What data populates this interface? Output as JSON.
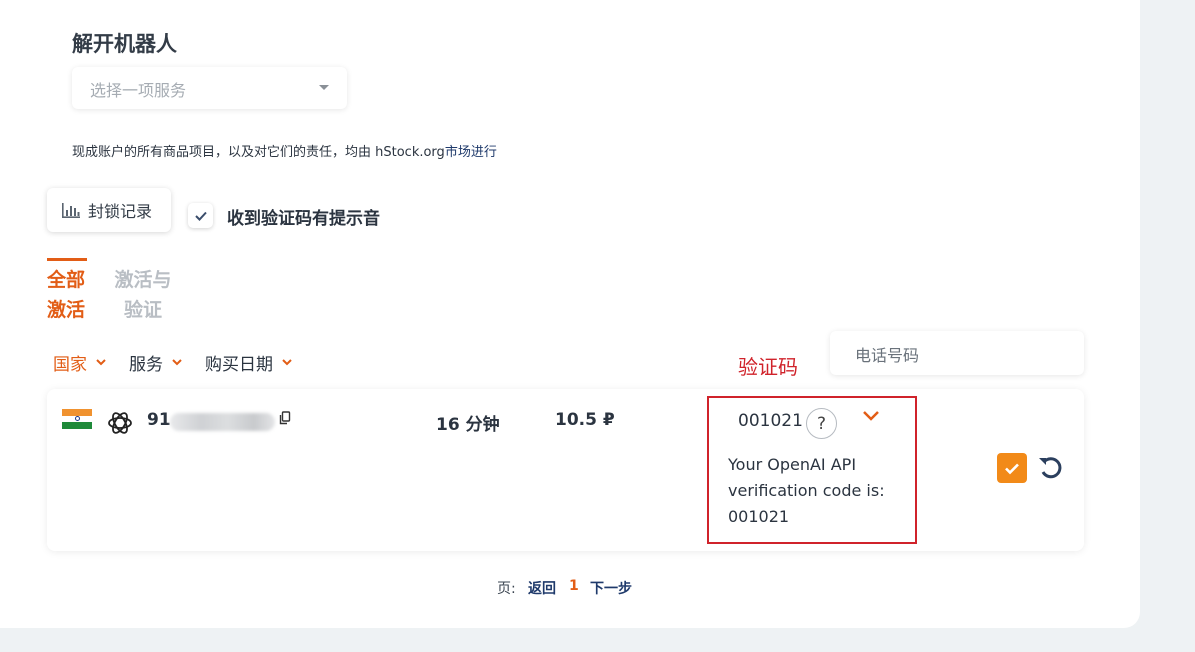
{
  "page_title": "解开机器人",
  "service_select": {
    "placeholder": "选择一项服务"
  },
  "notice": {
    "text": "现成账户的所有商品项目，以及对它们的责任，均由 hStock.org",
    "link": "市场进行"
  },
  "lock_history_button": {
    "label": "封锁记录",
    "icon": "bar-chart-icon"
  },
  "sound_option": {
    "checked": true,
    "label": "收到验证码有提示音"
  },
  "tabs": [
    {
      "label": "全部激活",
      "active": true
    },
    {
      "label": "激活与验证",
      "active": false
    }
  ],
  "filters": [
    {
      "label": "国家",
      "active": true
    },
    {
      "label": "服务",
      "active": false
    },
    {
      "label": "购买日期",
      "active": false
    }
  ],
  "phone_search": {
    "placeholder": "电话号码"
  },
  "annotation": {
    "label": "验证码",
    "color": "#d0232b"
  },
  "activation": {
    "country_flag": "india-flag-icon",
    "service_icon": "openai-icon",
    "phone_prefix": "91",
    "duration": "16 分钟",
    "price": "10.5 ₽",
    "code": "001021",
    "help": "?",
    "sms_text": "Your OpenAI API verification code is: 001021"
  },
  "pagination": {
    "label": "页:",
    "prev": "返回",
    "current": "1",
    "next": "下一步"
  },
  "colors": {
    "accent": "#e25d16",
    "confirm": "#f28a18",
    "link": "#1f3a6b"
  }
}
